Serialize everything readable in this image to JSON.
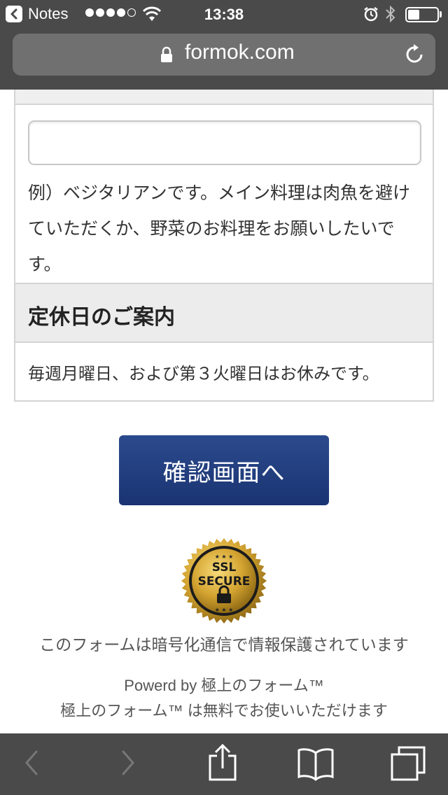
{
  "status_bar": {
    "back_app": "Notes",
    "time": "13:38"
  },
  "browser": {
    "url": "formok.com"
  },
  "form": {
    "example_text": "例）ベジタリアンです。メイン料理は肉魚を避けていただくか、野菜のお料理をお願いしたいです。",
    "holiday_section": {
      "title": "定休日のご案内",
      "body": "毎週月曜日、および第３火曜日はお休みです。"
    },
    "confirm_button": "確認画面へ"
  },
  "footer": {
    "ssl_badge_text": [
      "SSL",
      "SECURE"
    ],
    "ssl_note": "このフォームは暗号化通信で情報保護されています",
    "powered": "Powerd by 極上のフォーム™",
    "free_note": "極上のフォーム™ は無料でお使いいただけます"
  },
  "icons": {
    "back": "chevron-left-icon",
    "wifi": "wifi-icon",
    "alarm": "alarm-icon",
    "bluetooth": "bluetooth-icon",
    "battery": "battery-icon",
    "lock": "lock-icon",
    "reload": "reload-icon",
    "nav_back": "nav-back-icon",
    "nav_forward": "nav-forward-icon",
    "share": "share-icon",
    "bookmarks": "bookmarks-icon",
    "tabs": "tabs-icon"
  },
  "colors": {
    "chrome": "#4a4a4a",
    "button": "#1f3a7a",
    "badge_gold": "#d4a431"
  }
}
